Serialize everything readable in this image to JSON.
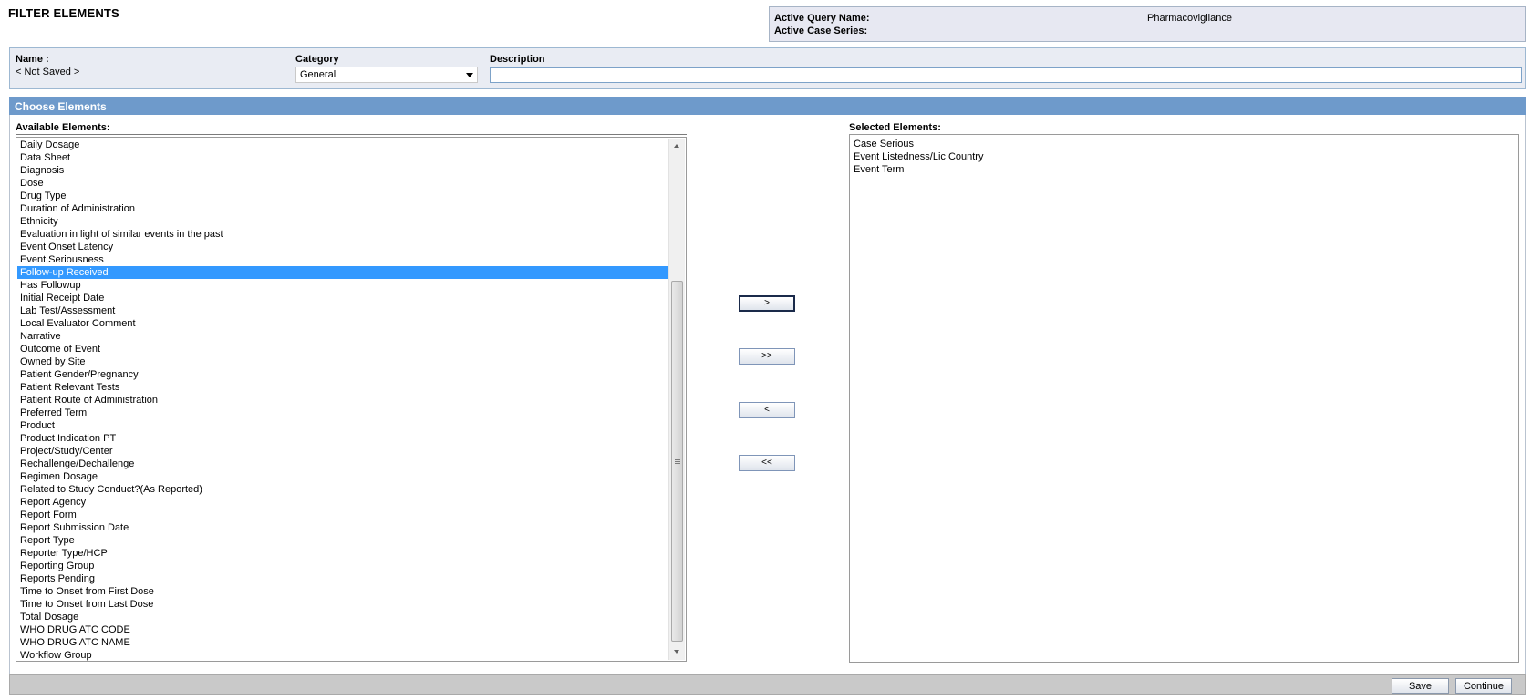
{
  "page": {
    "title": "FILTER ELEMENTS"
  },
  "query": {
    "active_query_label": "Active Query Name:",
    "active_query_value": "Pharmacovigilance",
    "active_case_series_label": "Active Case Series:"
  },
  "info": {
    "name_label": "Name :",
    "name_value": "< Not Saved >",
    "category_label": "Category",
    "category_value": "General",
    "description_label": "Description",
    "description_value": ""
  },
  "choose": {
    "header": "Choose Elements",
    "available_label": "Available Elements:",
    "selected_label": "Selected Elements:",
    "available_items": [
      "Daily Dosage",
      "Data Sheet",
      "Diagnosis",
      "Dose",
      "Drug Type",
      "Duration of Administration",
      "Ethnicity",
      "Evaluation in light of similar events in the past",
      "Event Onset Latency",
      "Event Seriousness",
      "Follow-up Received",
      "Has Followup",
      "Initial Receipt Date",
      "Lab Test/Assessment",
      "Local Evaluator Comment",
      "Narrative",
      "Outcome of Event",
      "Owned by Site",
      "Patient Gender/Pregnancy",
      "Patient Relevant Tests",
      "Patient Route of Administration",
      "Preferred Term",
      "Product",
      "Product Indication PT",
      "Project/Study/Center",
      "Rechallenge/Dechallenge",
      "Regimen Dosage",
      "Related to Study Conduct?(As Reported)",
      "Report Agency",
      "Report Form",
      "Report Submission Date",
      "Report Type",
      "Reporter Type/HCP",
      "Reporting Group",
      "Reports Pending",
      "Time to Onset from First Dose",
      "Time to Onset from Last Dose",
      "Total Dosage",
      "WHO DRUG ATC CODE",
      "WHO DRUG ATC NAME",
      "Workflow Group"
    ],
    "selected_available_item": "Follow-up Received",
    "selected_items": [
      "Case Serious",
      "Event Listedness/Lic Country",
      "Event Term"
    ],
    "buttons": {
      "add": ">",
      "add_all": ">>",
      "remove": "<",
      "remove_all": "<<"
    }
  },
  "footer": {
    "save_label": "Save",
    "continue_label": "Continue"
  }
}
